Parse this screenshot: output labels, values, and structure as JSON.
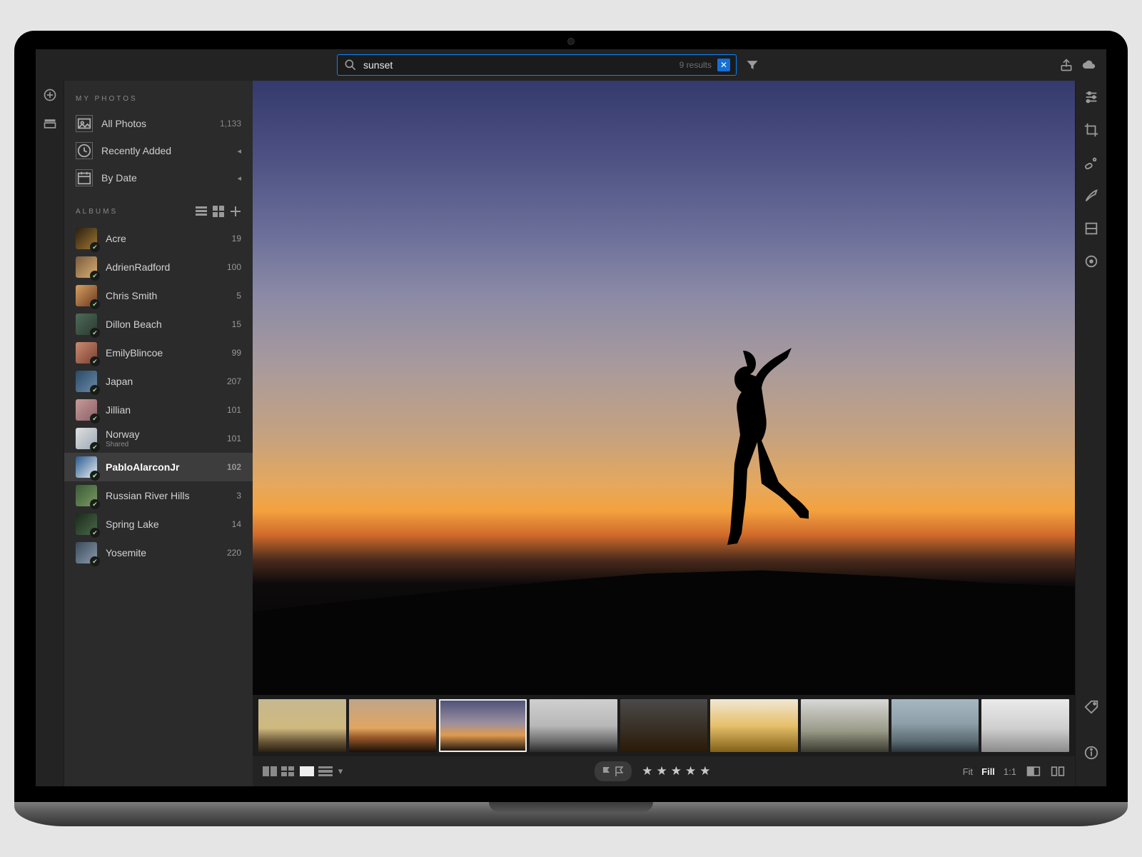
{
  "search": {
    "query": "sunset",
    "results_label": "9 results",
    "clear_glyph": "✕"
  },
  "sidebar": {
    "myPhotosTitle": "MY PHOTOS",
    "albumsTitle": "ALBUMS",
    "nav": [
      {
        "label": "All Photos",
        "count": "1,133",
        "icon": "photos"
      },
      {
        "label": "Recently Added",
        "chev": "◂",
        "icon": "clock"
      },
      {
        "label": "By Date",
        "chev": "◂",
        "icon": "calendar"
      }
    ],
    "albums": [
      {
        "name": "Acre",
        "count": "19",
        "thumb_bg": "linear-gradient(135deg,#2a1f12,#a07830)"
      },
      {
        "name": "AdrienRadford",
        "count": "100",
        "thumb_bg": "linear-gradient(135deg,#7a5a40,#d8b070)"
      },
      {
        "name": "Chris Smith",
        "count": "5",
        "thumb_bg": "linear-gradient(135deg,#d8a060,#6a3a20)"
      },
      {
        "name": "Dillon Beach",
        "count": "15",
        "thumb_bg": "linear-gradient(135deg,#4f6a58,#2a3a30)"
      },
      {
        "name": "EmilyBlincoe",
        "count": "99",
        "thumb_bg": "linear-gradient(135deg,#c98a70,#7a4030)"
      },
      {
        "name": "Japan",
        "count": "207",
        "thumb_bg": "linear-gradient(135deg,#2a4a68,#6a8aa8)"
      },
      {
        "name": "Jillian",
        "count": "101",
        "thumb_bg": "linear-gradient(135deg,#c89a98,#8a6068)"
      },
      {
        "name": "Norway",
        "count": "101",
        "sub": "Shared",
        "thumb_bg": "linear-gradient(135deg,#e0e0e0,#9aa8b4)"
      },
      {
        "name": "PabloAlarconJr",
        "count": "102",
        "selected": true,
        "thumb_bg": "linear-gradient(135deg,#2a5a90,#e8eef2)"
      },
      {
        "name": "Russian River Hills",
        "count": "3",
        "thumb_bg": "linear-gradient(135deg,#3a5a38,#7a9a60)"
      },
      {
        "name": "Spring Lake",
        "count": "14",
        "thumb_bg": "linear-gradient(135deg,#1a2a1a,#4a6a4a)"
      },
      {
        "name": "Yosemite",
        "count": "220",
        "thumb_bg": "linear-gradient(135deg,#3a4a5a,#8a9aaa)"
      }
    ]
  },
  "filmstrip": {
    "items": [
      {
        "cls": "g0"
      },
      {
        "cls": "g1"
      },
      {
        "cls": "g2",
        "selected": true
      },
      {
        "cls": "g3"
      },
      {
        "cls": "g4"
      },
      {
        "cls": "g5"
      },
      {
        "cls": "g6"
      },
      {
        "cls": "g7"
      },
      {
        "cls": "g8"
      }
    ]
  },
  "bottombar": {
    "stars_glyph": "★",
    "star_count": 5,
    "zoom": {
      "fit": "Fit",
      "fill": "Fill",
      "one": "1:1",
      "active": "fill"
    }
  }
}
